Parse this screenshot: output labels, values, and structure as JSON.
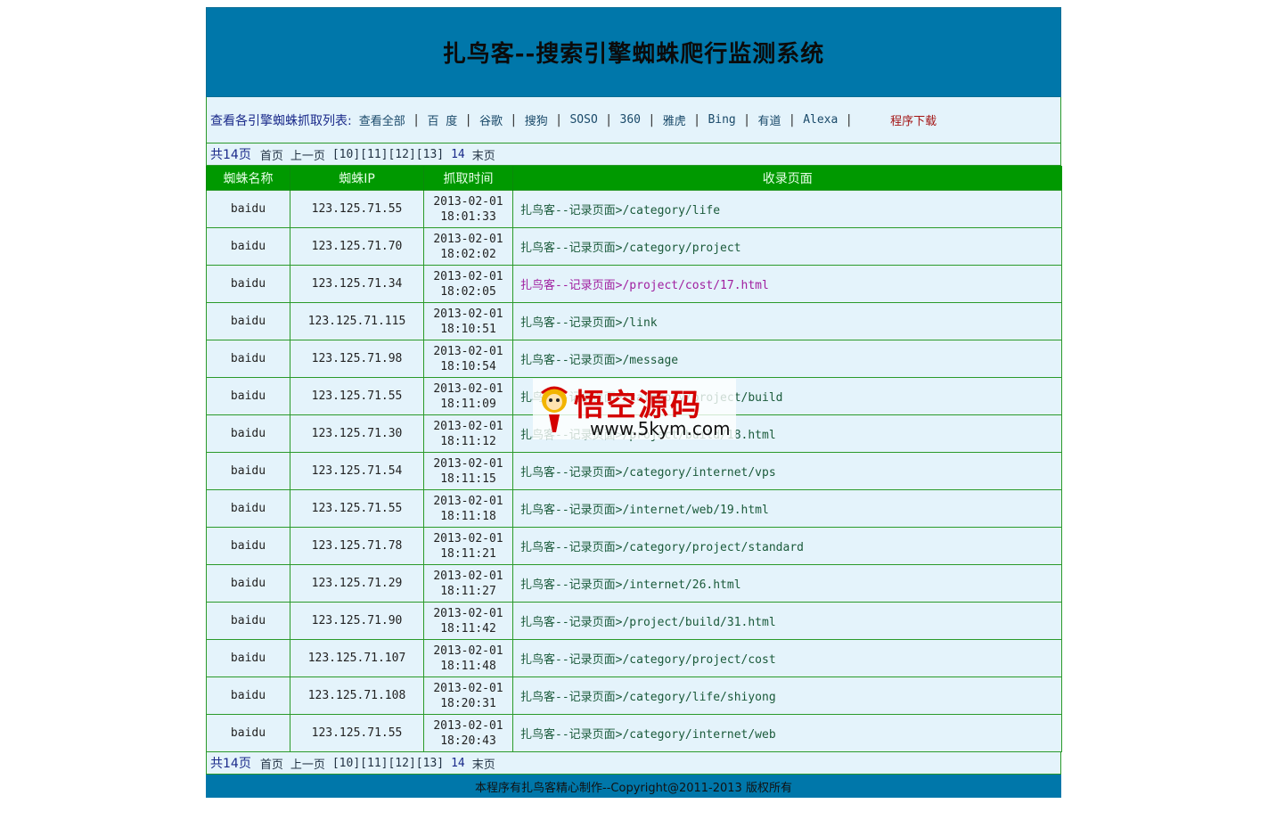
{
  "header": {
    "title": "扎鸟客--搜索引擎蜘蛛爬行监测系统"
  },
  "nav": {
    "lead": "查看各引擎蜘蛛抓取列表:",
    "items": [
      "查看全部",
      "百 度",
      "谷歌",
      "搜狗",
      "SOSO",
      "360",
      "雅虎",
      "Bing",
      "有道",
      "Alexa"
    ],
    "download": "程序下载"
  },
  "pager": {
    "total": "共14页",
    "first": "首页",
    "prev": "上一页",
    "pages": [
      "[10]",
      "[11]",
      "[12]",
      "[13]"
    ],
    "current": "14",
    "last": "末页"
  },
  "table": {
    "headers": [
      "蜘蛛名称",
      "蜘蛛IP",
      "抓取时间",
      "收录页面"
    ],
    "rows": [
      {
        "name": "baidu",
        "ip": "123.125.71.55",
        "date": "2013-02-01",
        "time": "18:01:33",
        "page": "扎鸟客--记录页面>/category/life",
        "visited": false
      },
      {
        "name": "baidu",
        "ip": "123.125.71.70",
        "date": "2013-02-01",
        "time": "18:02:02",
        "page": "扎鸟客--记录页面>/category/project",
        "visited": false
      },
      {
        "name": "baidu",
        "ip": "123.125.71.34",
        "date": "2013-02-01",
        "time": "18:02:05",
        "page": "扎鸟客--记录页面>/project/cost/17.html",
        "visited": true
      },
      {
        "name": "baidu",
        "ip": "123.125.71.115",
        "date": "2013-02-01",
        "time": "18:10:51",
        "page": "扎鸟客--记录页面>/link",
        "visited": false
      },
      {
        "name": "baidu",
        "ip": "123.125.71.98",
        "date": "2013-02-01",
        "time": "18:10:54",
        "page": "扎鸟客--记录页面>/message",
        "visited": false
      },
      {
        "name": "baidu",
        "ip": "123.125.71.55",
        "date": "2013-02-01",
        "time": "18:11:09",
        "page": "扎鸟客--记录页面>/category/project/build",
        "visited": false
      },
      {
        "name": "baidu",
        "ip": "123.125.71.30",
        "date": "2013-02-01",
        "time": "18:11:12",
        "page": "扎鸟客--记录页面>/project/build/18.html",
        "visited": false
      },
      {
        "name": "baidu",
        "ip": "123.125.71.54",
        "date": "2013-02-01",
        "time": "18:11:15",
        "page": "扎鸟客--记录页面>/category/internet/vps",
        "visited": false
      },
      {
        "name": "baidu",
        "ip": "123.125.71.55",
        "date": "2013-02-01",
        "time": "18:11:18",
        "page": "扎鸟客--记录页面>/internet/web/19.html",
        "visited": false
      },
      {
        "name": "baidu",
        "ip": "123.125.71.78",
        "date": "2013-02-01",
        "time": "18:11:21",
        "page": "扎鸟客--记录页面>/category/project/standard",
        "visited": false
      },
      {
        "name": "baidu",
        "ip": "123.125.71.29",
        "date": "2013-02-01",
        "time": "18:11:27",
        "page": "扎鸟客--记录页面>/internet/26.html",
        "visited": false
      },
      {
        "name": "baidu",
        "ip": "123.125.71.90",
        "date": "2013-02-01",
        "time": "18:11:42",
        "page": "扎鸟客--记录页面>/project/build/31.html",
        "visited": false
      },
      {
        "name": "baidu",
        "ip": "123.125.71.107",
        "date": "2013-02-01",
        "time": "18:11:48",
        "page": "扎鸟客--记录页面>/category/project/cost",
        "visited": false
      },
      {
        "name": "baidu",
        "ip": "123.125.71.108",
        "date": "2013-02-01",
        "time": "18:20:31",
        "page": "扎鸟客--记录页面>/category/life/shiyong",
        "visited": false
      },
      {
        "name": "baidu",
        "ip": "123.125.71.55",
        "date": "2013-02-01",
        "time": "18:20:43",
        "page": "扎鸟客--记录页面>/category/internet/web",
        "visited": false
      }
    ]
  },
  "footer": {
    "text": "本程序有扎鸟客精心制作--Copyright@2011-2013 版权所有"
  },
  "watermark": {
    "brand": "悟空源码",
    "url": "www.5kym.com",
    "icon": "monkey-king-logo-icon"
  },
  "colors": {
    "header_bg": "#0077aa",
    "table_head_bg": "#009900",
    "row_bg": "#e4f3fb",
    "border": "#2a9a2a",
    "visited_link": "#a020a0",
    "download_link": "#a31515"
  }
}
